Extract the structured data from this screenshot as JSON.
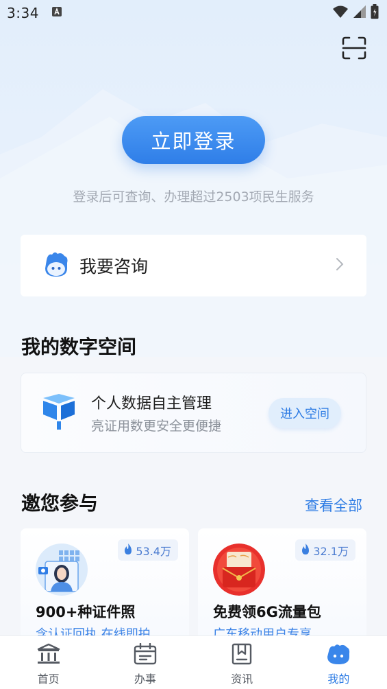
{
  "status_bar": {
    "time": "3:34",
    "icons": [
      "notification-a-icon",
      "wifi-icon",
      "signal-icon",
      "battery-icon"
    ]
  },
  "header": {
    "scan_icon": "scan-icon"
  },
  "login": {
    "button_label": "立即登录",
    "tip": "登录后可查询、办理超过2503项民生服务"
  },
  "consult": {
    "label": "我要咨询",
    "icon": "assistant-mascot-icon"
  },
  "digital_space": {
    "section_title": "我的数字空间",
    "card_title": "个人数据自主管理",
    "card_subtitle": "亮证用数更安全更便捷",
    "enter_label": "进入空间",
    "icon": "digital-space-logo-icon"
  },
  "participate": {
    "section_title": "邀您参与",
    "see_all_label": "查看全部",
    "cards": [
      {
        "title": "900+种证件照",
        "subtitle": "含认证回执 在线即拍",
        "badge": "53.4万",
        "image": "id-photo-illustration"
      },
      {
        "title": "免费领6G流量包",
        "subtitle": "广东移动用户专享",
        "badge": "32.1万",
        "image": "red-packet-illustration"
      }
    ]
  },
  "tabbar": {
    "items": [
      {
        "label": "首页",
        "icon": "home-building-icon",
        "active": false
      },
      {
        "label": "办事",
        "icon": "calendar-icon",
        "active": false
      },
      {
        "label": "资讯",
        "icon": "bookmark-news-icon",
        "active": false
      },
      {
        "label": "我的",
        "icon": "profile-mascot-icon",
        "active": true
      }
    ]
  },
  "colors": {
    "accent": "#2e7ce4",
    "badge_text": "#4a7bd0",
    "muted_text": "#a3a9b3"
  }
}
